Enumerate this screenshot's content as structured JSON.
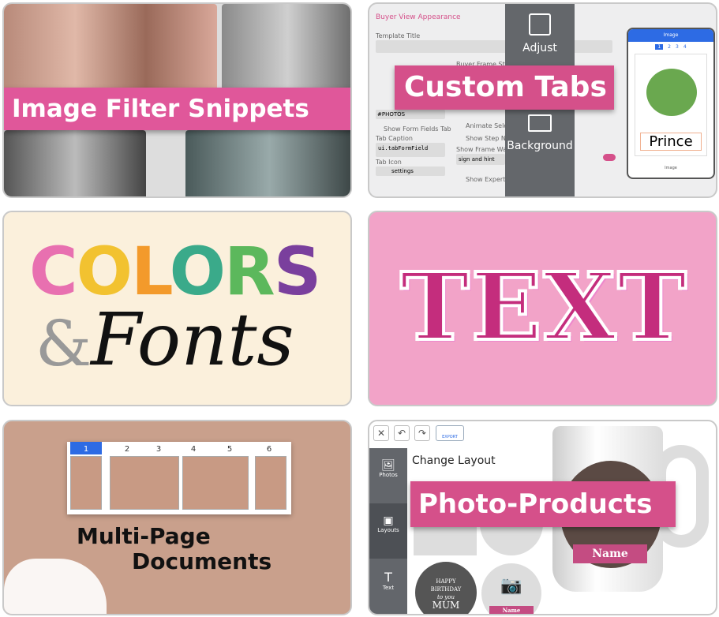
{
  "cards": [
    {
      "title": "Image Filter Snippets"
    },
    {
      "title": "Custom Tabs",
      "panel_title": "Buyer View Appearance",
      "template_title_label": "Template Title",
      "initial_tab_value": "#PHOTOS",
      "show_form_fields_tab": "Show Form Fields Tab",
      "tab_caption_label": "Tab Caption",
      "tab_caption_value": "ui.tabFormField",
      "tab_icon_label": "Tab Icon",
      "tab_icon_value": "settings",
      "buyer_frame_style": "Buyer Frame Style",
      "animate_selection": "Animate Selection",
      "show_step_numbers": "Show Step Numbers",
      "show_frame_warnings": "Show Frame Warnings",
      "frame_warnings_value": "sign and hint",
      "show_expert_mode": "Show Expert Mode",
      "side_tabs": [
        "Adjust",
        "Background"
      ],
      "phone_header": "Image",
      "phone_pages": [
        "1",
        "2",
        "3",
        "4"
      ],
      "phone_text": "Prince",
      "phone_footer": "Image"
    },
    {
      "title_colors": "COLORS",
      "amp": "&",
      "title_fonts": "Fonts",
      "letter_colors": [
        "#e870b0",
        "#f2c230",
        "#f39a2b",
        "#3aaa8a",
        "#5cb85c",
        "#7a3f9d"
      ]
    },
    {
      "title": "TEXT"
    },
    {
      "title_line1": "Multi-Page",
      "title_line2": "Documents",
      "pages": [
        "1",
        "2",
        "3",
        "4",
        "5",
        "6"
      ]
    },
    {
      "title": "Photo-Products",
      "export": "EXPORT",
      "change_layout": "Change Layout",
      "rail": [
        "Photos",
        "Layouts",
        "Text"
      ],
      "mug_name": "Name",
      "birthday": [
        "HAPPY",
        "BIRTHDAY",
        "to you",
        "MUM"
      ],
      "small_name": "Name"
    }
  ],
  "colors": {
    "accent_pink": "#d5508a"
  }
}
